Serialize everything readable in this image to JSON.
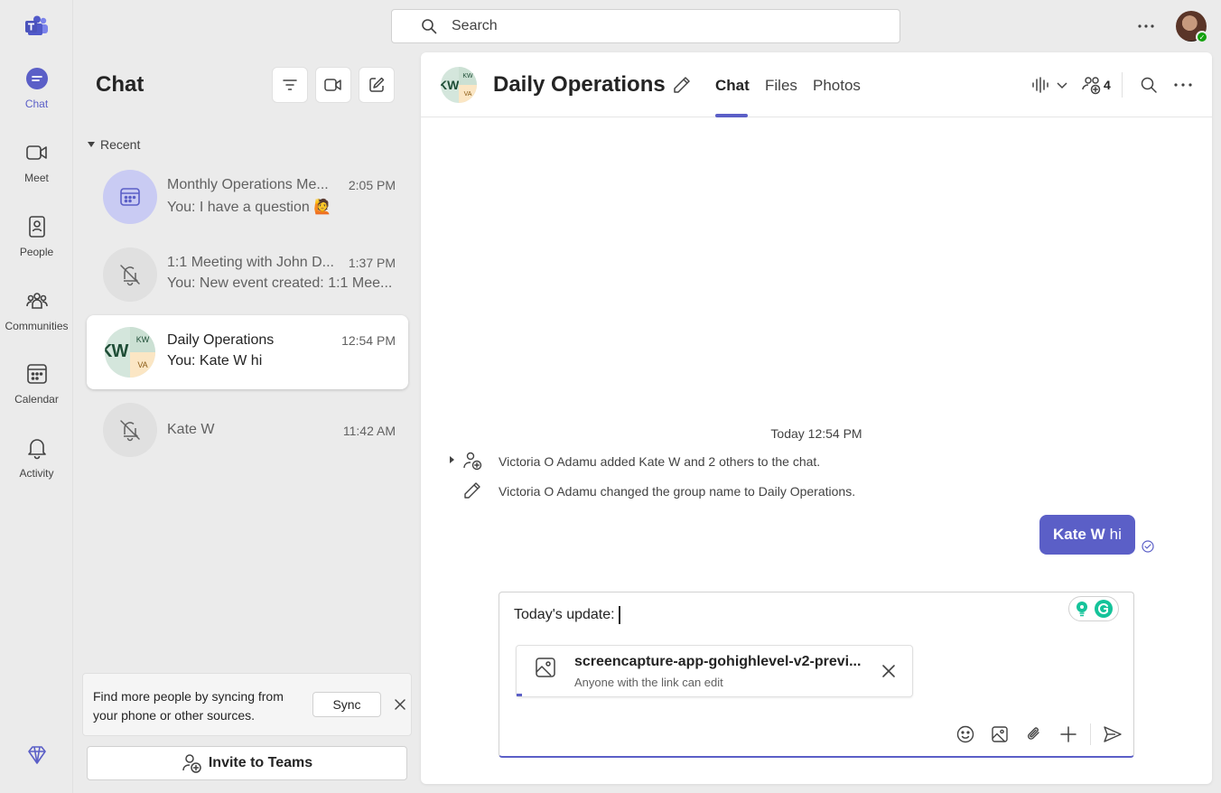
{
  "rail": {
    "items": [
      {
        "label": "Chat",
        "icon": "chat-icon",
        "active": true
      },
      {
        "label": "Meet",
        "icon": "video-camera-icon"
      },
      {
        "label": "People",
        "icon": "people-book-icon"
      },
      {
        "label": "Communities",
        "icon": "communities-icon"
      },
      {
        "label": "Calendar",
        "icon": "calendar-icon"
      },
      {
        "label": "Activity",
        "icon": "bell-icon"
      }
    ]
  },
  "search": {
    "placeholder": "Search"
  },
  "chat_list": {
    "title": "Chat",
    "section": "Recent",
    "items": [
      {
        "name": "Monthly Operations Me...",
        "time": "2:05 PM",
        "preview": "You: I have a question 🙋"
      },
      {
        "name": "1:1 Meeting with John D...",
        "time": "1:37 PM",
        "preview": "You: New event created: 1:1 Mee..."
      },
      {
        "name": "Daily Operations",
        "time": "12:54 PM",
        "preview": "You: Kate W hi"
      },
      {
        "name": "Kate W",
        "time": "11:42 AM",
        "preview": ""
      }
    ],
    "avatar_initials": {
      "big": "KW",
      "top": "KW",
      "bottom": "VA"
    }
  },
  "sync_card": {
    "message": "Find more people by syncing from your phone or other sources.",
    "button": "Sync"
  },
  "invite": {
    "label": "Invite to Teams"
  },
  "conversation": {
    "title": "Daily Operations",
    "tabs": [
      "Chat",
      "Files",
      "Photos"
    ],
    "participants_count": "4",
    "timestamp": "Today 12:54 PM",
    "system_messages": [
      "Victoria O Adamu added Kate W and 2 others to the chat.",
      "Victoria O Adamu changed the group name to Daily Operations."
    ],
    "bubble": {
      "mention": "Kate W",
      "text": "hi"
    }
  },
  "compose": {
    "text": "Today's update:",
    "attachment": {
      "name": "screencapture-app-gohighlevel-v2-previ...",
      "permission": "Anyone with the link can edit"
    }
  },
  "colors": {
    "accent": "#5b5fc7",
    "presence": "#13a10e",
    "background": "#ebebeb"
  }
}
